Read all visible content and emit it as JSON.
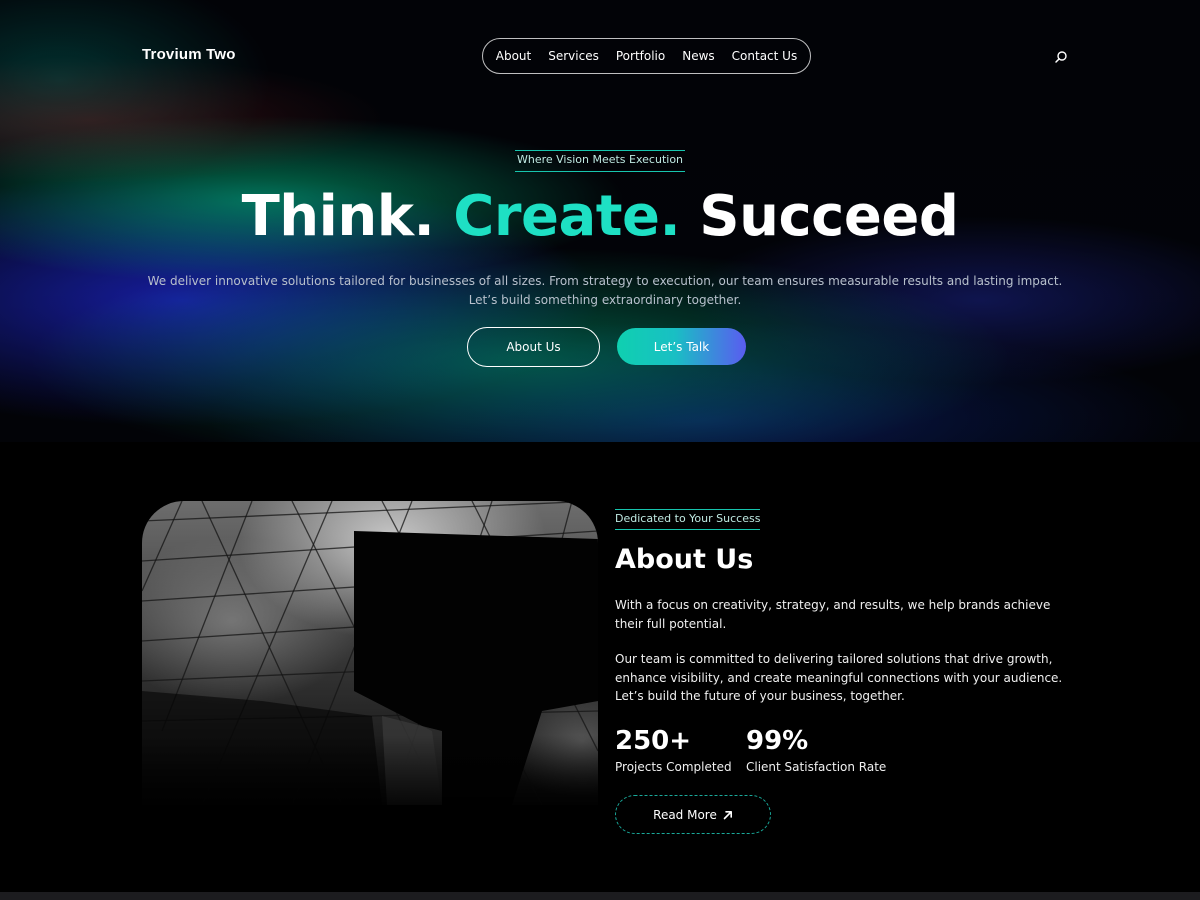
{
  "brand": {
    "name": "Trovium Two"
  },
  "nav": {
    "items": [
      {
        "label": "About"
      },
      {
        "label": "Services"
      },
      {
        "label": "Portfolio"
      },
      {
        "label": "News"
      },
      {
        "label": "Contact Us"
      }
    ],
    "search_icon": "search-icon"
  },
  "hero": {
    "eyebrow": "Where Vision Meets Execution",
    "headline": {
      "part1": "Think.",
      "part2": "Create.",
      "part3": "Succeed"
    },
    "description": "We deliver innovative solutions tailored for businesses of all sizes. From strategy to execution, our team ensures measurable results and lasting impact. Let’s build something extraordinary together.",
    "primary_button": "About Us",
    "secondary_button": "Let’s Talk"
  },
  "about": {
    "eyebrow": "Dedicated to Your Success",
    "title": "About Us",
    "paragraph1": "With a focus on creativity, strategy, and results, we help brands achieve their full potential.",
    "paragraph2": "Our team is committed to delivering tailored solutions that drive growth, enhance visibility, and create meaningful connections with your audience. Let’s build the future of your business, together.",
    "stats": [
      {
        "value": "250+",
        "label": "Projects Completed"
      },
      {
        "value": "99%",
        "label": "Client Satisfaction Rate"
      }
    ],
    "button": "Read More",
    "button_icon": "arrow-up-right-icon"
  },
  "colors": {
    "accent": "#1ee0c4",
    "background": "#000000",
    "gradient_start": "#0fd0b0",
    "gradient_end": "#5a5cf0"
  }
}
